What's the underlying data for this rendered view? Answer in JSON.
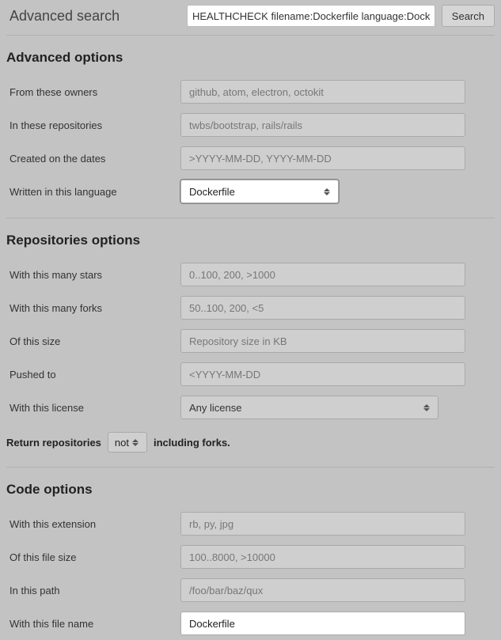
{
  "header": {
    "label": "Advanced search",
    "search_value": "HEALTHCHECK filename:Dockerfile language:Dockerfile",
    "search_button": "Search"
  },
  "advanced_options": {
    "title": "Advanced options",
    "owners_label": "From these owners",
    "owners_placeholder": "github, atom, electron, octokit",
    "repos_label": "In these repositories",
    "repos_placeholder": "twbs/bootstrap, rails/rails",
    "dates_label": "Created on the dates",
    "dates_placeholder": ">YYYY-MM-DD, YYYY-MM-DD",
    "language_label": "Written in this language",
    "language_value": "Dockerfile"
  },
  "repo_options": {
    "title": "Repositories options",
    "stars_label": "With this many stars",
    "stars_placeholder": "0..100, 200, >1000",
    "forks_label": "With this many forks",
    "forks_placeholder": "50..100, 200, <5",
    "size_label": "Of this size",
    "size_placeholder": "Repository size in KB",
    "pushed_label": "Pushed to",
    "pushed_placeholder": "<YYYY-MM-DD",
    "license_label": "With this license",
    "license_value": "Any license",
    "fork_prefix": "Return repositories",
    "fork_value": "not",
    "fork_suffix": "including forks."
  },
  "code_options": {
    "title": "Code options",
    "ext_label": "With this extension",
    "ext_placeholder": "rb, py, jpg",
    "filesize_label": "Of this file size",
    "filesize_placeholder": "100..8000, >10000",
    "path_label": "In this path",
    "path_placeholder": "/foo/bar/baz/qux",
    "filename_label": "With this file name",
    "filename_value": "Dockerfile"
  }
}
